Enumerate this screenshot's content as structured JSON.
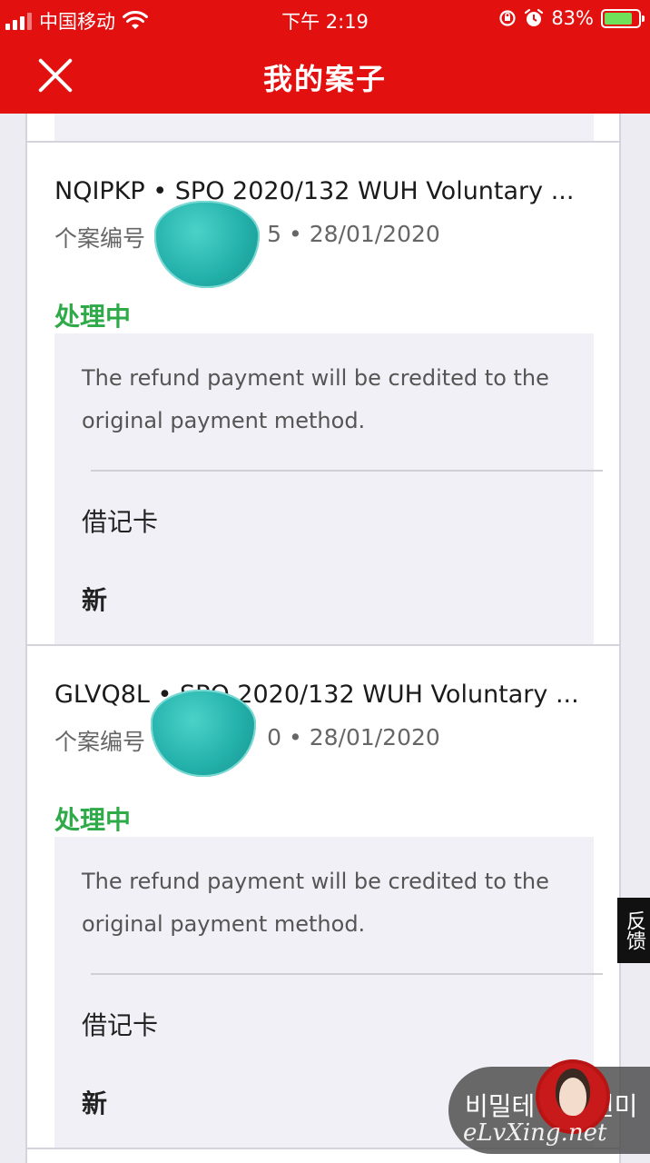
{
  "status_bar": {
    "carrier": "中国移动",
    "time": "下午 2:19",
    "battery": "83%",
    "battery_level": 0.83
  },
  "header": {
    "title": "我的案子"
  },
  "cases": [
    {
      "title": "NQIPKP • SPO 2020/132 WUH Voluntary ...",
      "case_label": "个案编号",
      "case_number_tail": "5",
      "date": "• 28/01/2020",
      "status": "处理中",
      "message": "The refund payment will be credited to the original payment method.",
      "payment_label": "借记卡",
      "payment_status": "新"
    },
    {
      "title": "GLVQ8L • SPO 2020/132 WUH Voluntary ...",
      "case_label": "个案编号",
      "case_number_tail": "0",
      "date": "• 28/01/2020",
      "status": "处理中",
      "message": "The refund payment will be credited to the original payment method.",
      "payment_label": "借记卡",
      "payment_status": "新"
    }
  ],
  "feedback": "反馈",
  "overlay": {
    "text": "비밀테이프-선미",
    "watermark": "eLvXing.net"
  },
  "colors": {
    "header_bg": "#e31010",
    "status_green": "#2faa48",
    "box_bg": "#f0f0f6"
  }
}
